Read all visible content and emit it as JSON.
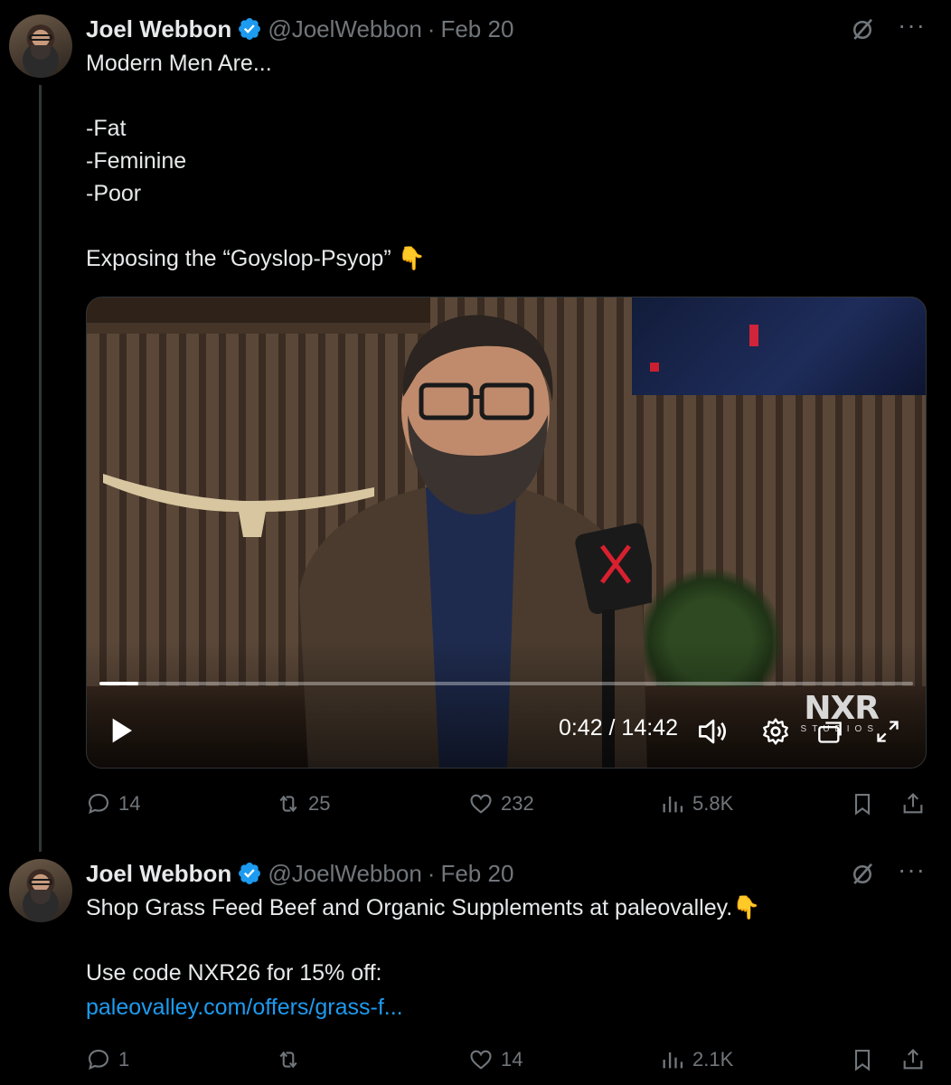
{
  "tweets": [
    {
      "author": {
        "name": "Joel Webbon",
        "handle": "@JoelWebbon",
        "date": "Feb 20",
        "verified": true
      },
      "text": "Modern Men Are...\n\n-Fat\n-Feminine\n-Poor\n\nExposing the “Goyslop-Psyop” 👇",
      "video": {
        "current_time": "0:42",
        "duration": "14:42",
        "time_display": "0:42 / 14:42",
        "progress_fraction": 0.048,
        "watermark": "NXR",
        "watermark_sub": "STUDIOS"
      },
      "stats": {
        "replies": "14",
        "retweets": "25",
        "likes": "232",
        "views": "5.8K"
      }
    },
    {
      "author": {
        "name": "Joel Webbon",
        "handle": "@JoelWebbon",
        "date": "Feb 20",
        "verified": true
      },
      "text": "Shop Grass Feed Beef and Organic Supplements at paleovalley.👇\n\nUse code NXR26 for 15% off:",
      "link": "paleovalley.com/offers/grass-f...",
      "stats": {
        "replies": "1",
        "retweets": "",
        "likes": "14",
        "views": "2.1K"
      }
    }
  ],
  "colors": {
    "background": "#000000",
    "text": "#e7e9ea",
    "muted": "#71767b",
    "link": "#1d9bf0",
    "verified": "#1d9bf0",
    "thread_line": "#333639"
  },
  "icons": [
    "verified-badge-icon",
    "grok-icon",
    "more-icon",
    "play-icon",
    "volume-icon",
    "settings-gear-icon",
    "picture-in-picture-icon",
    "fullscreen-icon",
    "reply-icon",
    "retweet-icon",
    "like-icon",
    "views-icon",
    "bookmark-icon",
    "share-icon"
  ]
}
